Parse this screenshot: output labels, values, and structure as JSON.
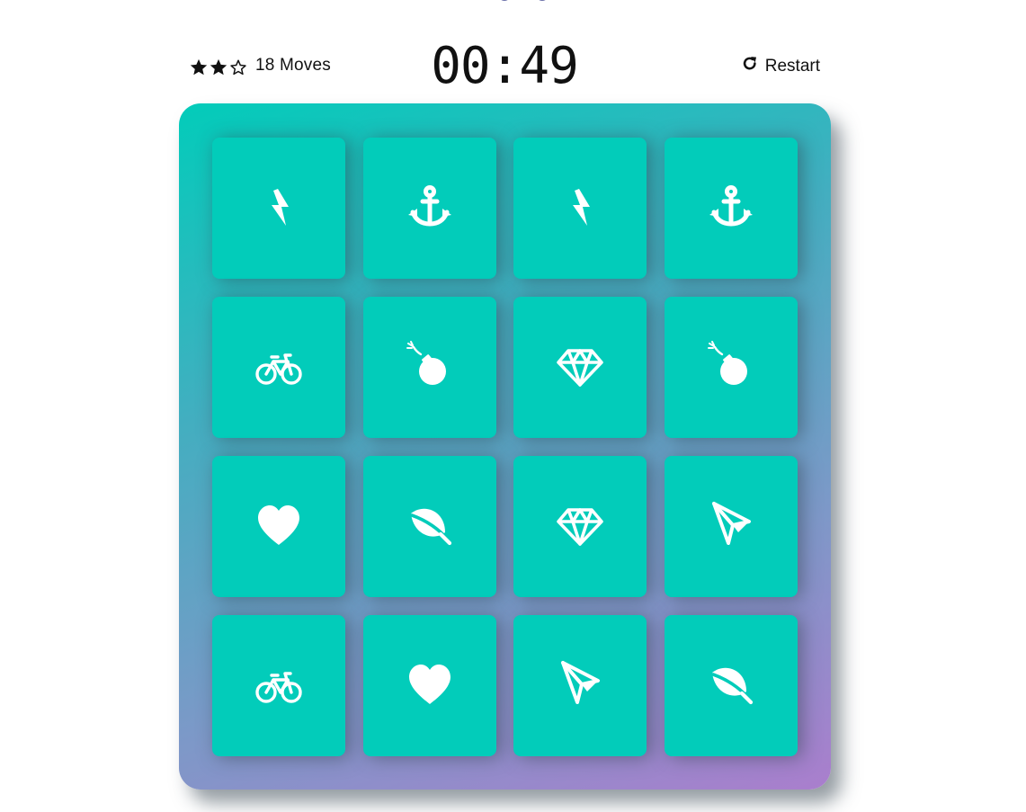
{
  "score": {
    "stars": [
      {
        "state": "filled",
        "icon": "star-icon"
      },
      {
        "state": "filled",
        "icon": "star-icon"
      },
      {
        "state": "empty",
        "icon": "star-outline-icon"
      }
    ],
    "moves_text": "18 Moves",
    "timer": "00:49",
    "restart_label": "Restart",
    "restart_icon": "refresh-icon"
  },
  "colors": {
    "card": "#02ccba",
    "icon": "#ffffff",
    "deck_gradient_start": "#02ccba",
    "deck_gradient_end": "#aa7ecd"
  },
  "deck": {
    "rows": [
      [
        "bolt",
        "anchor",
        "bolt",
        "anchor"
      ],
      [
        "bicycle",
        "bomb",
        "diamond",
        "bomb"
      ],
      [
        "heart",
        "leaf",
        "diamond",
        "paper-plane"
      ],
      [
        "bicycle",
        "heart",
        "paper-plane",
        "leaf"
      ]
    ]
  }
}
